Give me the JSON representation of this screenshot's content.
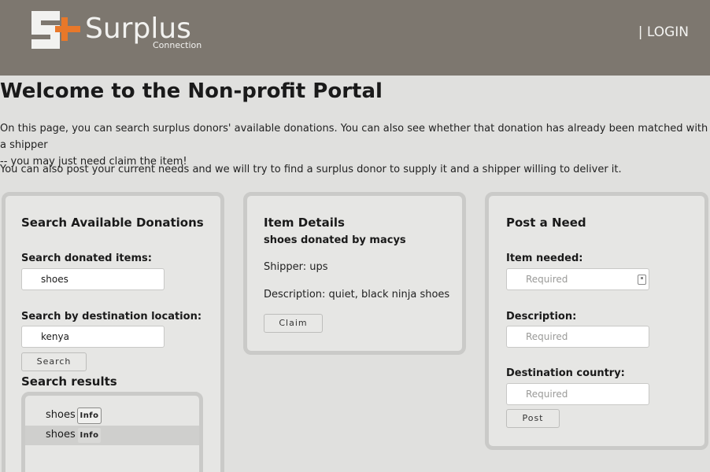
{
  "header": {
    "logo_word": "Surplus",
    "logo_sub": "Connection",
    "login": "| LOGIN",
    "logo_colors": {
      "mark": "#f2f2f0",
      "plus": "#e8782a"
    }
  },
  "intro": {
    "title": "Welcome to the Non-profit Portal",
    "para1_line1": "On this page, you can search surplus donors' available donations. You can also see whether that donation has already been matched with a shipper",
    "para1_line2": "-- you may just need claim the item!",
    "para2": "You can also post your current needs and we will try to find a surplus donor to supply it and a shipper willing to deliver it."
  },
  "search_panel": {
    "title": "Search Available Donations",
    "items_label": "Search donated items:",
    "items_value": "shoes",
    "location_label": "Search by destination location:",
    "location_value": "kenya",
    "search_button": "Search",
    "results_title": "Search results",
    "results": [
      {
        "name": "shoes",
        "info": "Info"
      },
      {
        "name": "shoes",
        "info": "Info"
      }
    ]
  },
  "item_panel": {
    "title": "Item Details",
    "subtitle": "shoes donated by macys",
    "shipper": "Shipper: ups",
    "description": "Description: quiet, black ninja shoes",
    "claim_button": "Claim"
  },
  "need_panel": {
    "title": "Post a Need",
    "item_label": "Item needed:",
    "item_placeholder": "Required",
    "description_label": "Description:",
    "description_placeholder": "Required",
    "country_label": "Destination country:",
    "country_placeholder": "Required",
    "post_button": "Post"
  }
}
